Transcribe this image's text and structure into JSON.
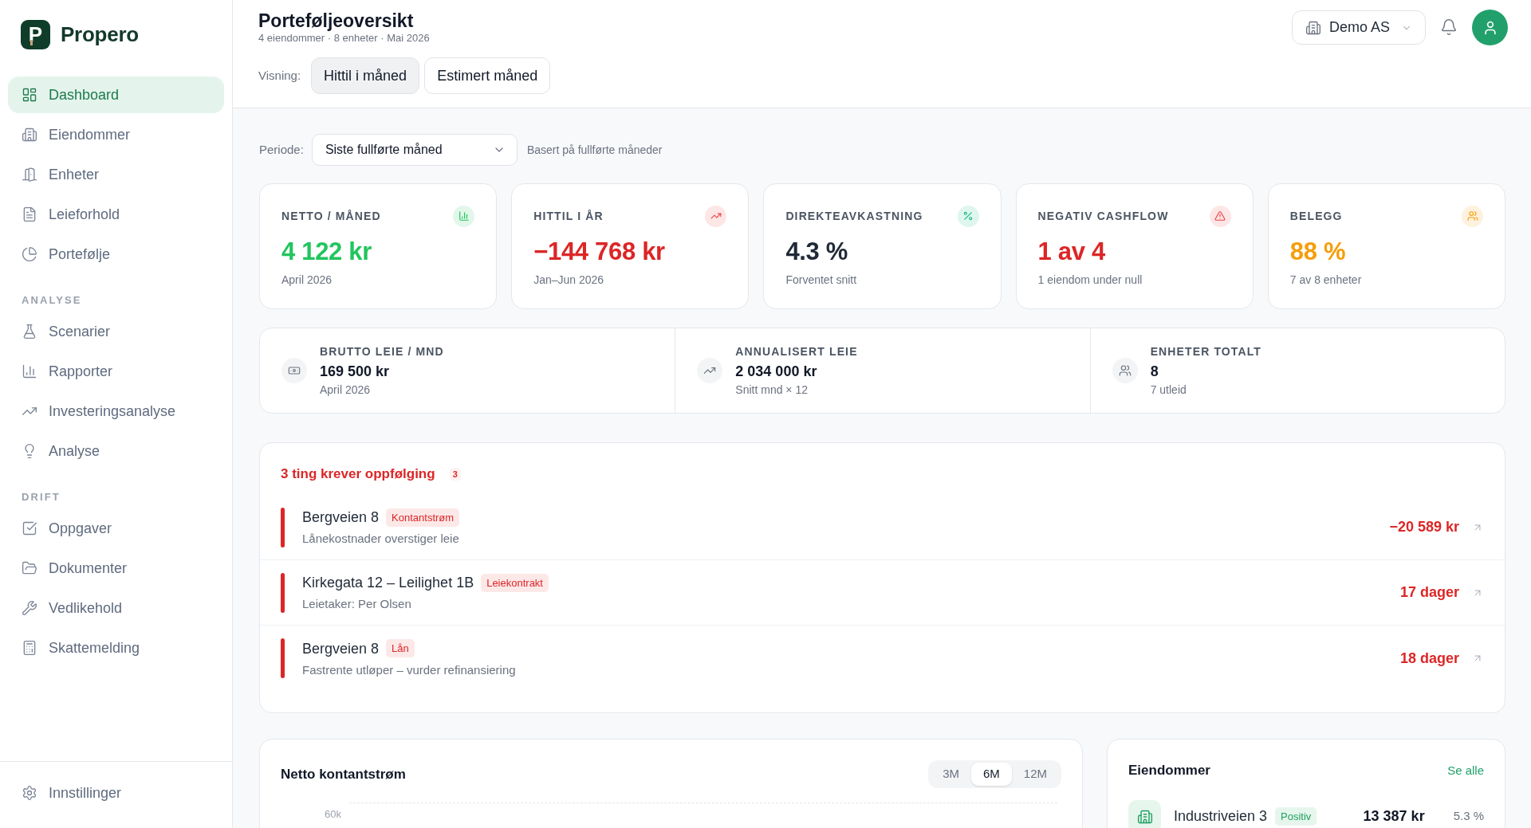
{
  "sidebar": {
    "logo_letter": "P",
    "brand": "Propero",
    "sections": [
      {
        "items": [
          {
            "label": "Dashboard",
            "selected": true
          },
          {
            "label": "Eiendommer",
            "selected": false
          },
          {
            "label": "Enheter",
            "selected": false
          },
          {
            "label": "Leieforhold",
            "selected": false
          },
          {
            "label": "Portefølje",
            "selected": false
          }
        ]
      },
      {
        "heading": "ANALYSE",
        "items": [
          {
            "label": "Scenarier",
            "selected": false
          },
          {
            "label": "Rapporter",
            "selected": false
          },
          {
            "label": "Investeringsanalyse",
            "selected": false
          },
          {
            "label": "Analyse",
            "selected": false
          }
        ]
      },
      {
        "heading": "DRIFT",
        "items": [
          {
            "label": "Oppgaver",
            "selected": false
          },
          {
            "label": "Dokumenter",
            "selected": false
          },
          {
            "label": "Vedlikehold",
            "selected": false
          },
          {
            "label": "Skattemelding",
            "selected": false
          }
        ]
      }
    ],
    "footer_item": {
      "label": "Innstillinger",
      "selected": false
    }
  },
  "header": {
    "title": "Porteføljeoversikt",
    "subtitle": "4 eiendommer · 8 enheter · Mai 2026",
    "view_label": "Visning:",
    "view_options": [
      {
        "label": "Hittil i måned",
        "selected": true
      },
      {
        "label": "Estimert måned",
        "selected": false
      }
    ],
    "company": "Demo AS"
  },
  "filter": {
    "label": "Periode:",
    "value": "Siste fullførte måned",
    "hint": "Basert på fullførte måneder"
  },
  "kpis": [
    {
      "title": "NETTO / MÅNED",
      "value": "4 122 kr",
      "caption": "April 2026",
      "color": "#22c55e",
      "icon": {
        "color": "#22c55e"
      }
    },
    {
      "title": "HITTIL I ÅR",
      "value": "−144 768 kr",
      "caption": "Jan–Jun 2026",
      "color": "#dc2626",
      "icon": {
        "color": "#ef4444"
      }
    },
    {
      "title": "DIREKTEAVKASTNING",
      "value": "4.3 %",
      "caption": "Forventet snitt",
      "color": "#1f2937",
      "icon": {
        "color": "#10b981"
      }
    },
    {
      "title": "NEGATIV CASHFLOW",
      "value": "1 av 4",
      "caption": "1 eiendom under null",
      "color": "#dc2626",
      "icon": {
        "color": "#ef4444"
      }
    },
    {
      "title": "BELEGG",
      "value": "88 %",
      "caption": "7 av 8 enheter",
      "color": "#f59e0b",
      "icon": {
        "color": "#f59e0b"
      }
    }
  ],
  "summary": [
    {
      "title": "BRUTTO LEIE / MND",
      "value": "169 500 kr",
      "caption": "April 2026"
    },
    {
      "title": "ANNUALISERT LEIE",
      "value": "2 034 000 kr",
      "caption": "Snitt mnd × 12"
    },
    {
      "title": "ENHETER TOTALT",
      "value": "8",
      "caption": "7 utleid"
    }
  ],
  "follow_up": {
    "title": "3 ting krever oppfølging",
    "count": "3",
    "items": [
      {
        "name": "Bergveien 8",
        "tag": "Kontantstrøm",
        "detail": "Lånekostnader overstiger leie",
        "amount": "−20 589 kr"
      },
      {
        "name": "Kirkegata 12 – Leilighet 1B",
        "tag": "Leiekontrakt",
        "detail": "Leietaker: Per Olsen",
        "amount": "17 dager"
      },
      {
        "name": "Bergveien 8",
        "tag": "Lån",
        "detail": "Fastrente utløper – vurder refinansiering",
        "amount": "18 dager"
      }
    ]
  },
  "cashflow_chart": {
    "title": "Netto kontantstrøm",
    "ranges": [
      {
        "label": "3M",
        "selected": false
      },
      {
        "label": "6M",
        "selected": true
      },
      {
        "label": "12M",
        "selected": false
      }
    ],
    "y_axis_labels": [
      "60k"
    ]
  },
  "properties": {
    "title": "Eiendommer",
    "link": "Se alle",
    "rows": [
      {
        "name": "Industriveien 3",
        "status": "Positiv",
        "amount": "13 387 kr",
        "yield": "5.3 %"
      }
    ]
  }
}
